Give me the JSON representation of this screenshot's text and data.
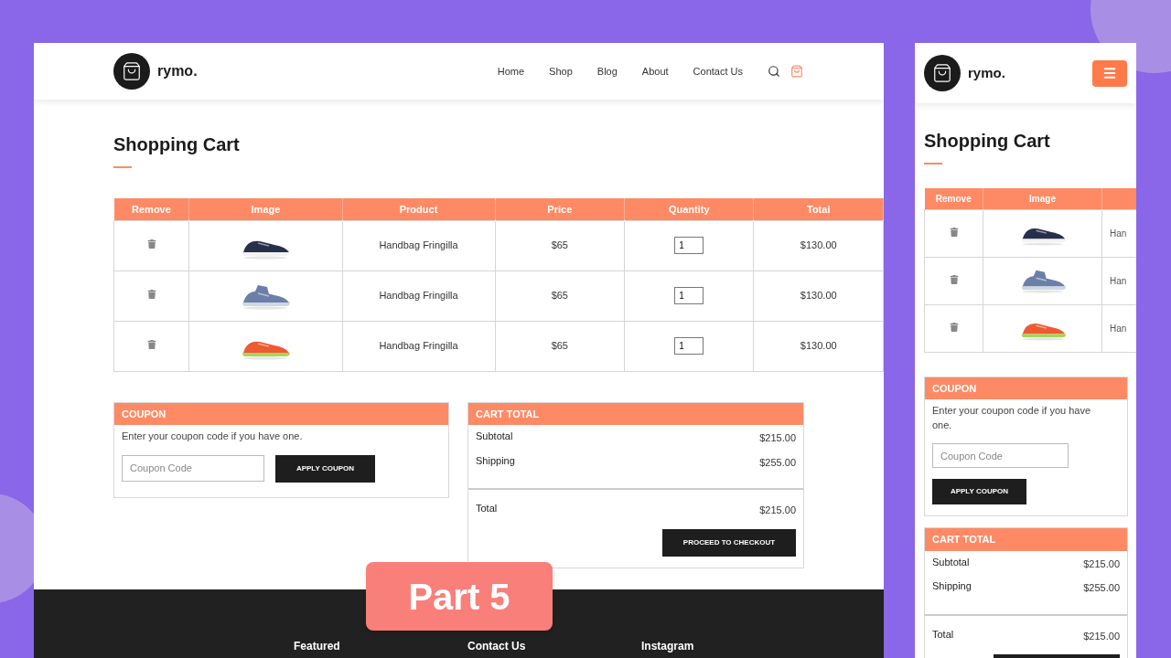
{
  "desktop": {
    "logo": "rymo.",
    "nav": [
      {
        "label": "Home"
      },
      {
        "label": "Shop"
      },
      {
        "label": "Blog"
      },
      {
        "label": "About"
      },
      {
        "label": "Contact Us"
      }
    ],
    "title": "Shopping Cart",
    "columns": [
      "Remove",
      "Image",
      "Product",
      "Price",
      "Quantity",
      "Total"
    ],
    "rows": [
      {
        "product": "Handbag Fringilla",
        "price": "$65",
        "quantity": "1",
        "total": "$130.00"
      },
      {
        "product": "Handbag Fringilla",
        "price": "$65",
        "quantity": "1",
        "total": "$130.00"
      },
      {
        "product": "Handbag Fringilla",
        "price": "$65",
        "quantity": "1",
        "total": "$130.00"
      }
    ],
    "coupon": {
      "title": "COUPON",
      "text": "Enter your coupon code if you have one.",
      "placeholder": "Coupon Code",
      "button": "APPLY COUPON"
    },
    "cart_total": {
      "title": "CART TOTAL",
      "lines": [
        {
          "label": "Subtotal",
          "value": "$215.00"
        },
        {
          "label": "Shipping",
          "value": "$255.00"
        }
      ],
      "total": {
        "label": "Total",
        "value": "$215.00"
      },
      "button": "PROCEED TO CHECKOUT"
    },
    "footer_headings": [
      "Featured",
      "Contact Us",
      "Instagram"
    ]
  },
  "mobile": {
    "logo": "rymo.",
    "title": "Shopping Cart",
    "columns": [
      "Remove",
      "Image"
    ],
    "rows": [
      {
        "product": "Han"
      },
      {
        "product": "Han"
      },
      {
        "product": "Han"
      }
    ],
    "coupon": {
      "title": "COUPON",
      "text": "Enter your coupon code if you have one.",
      "placeholder": "Coupon Code",
      "button": "APPLY COUPON"
    },
    "cart_total": {
      "title": "CART TOTAL",
      "lines": [
        {
          "label": "Subtotal",
          "value": "$215.00"
        },
        {
          "label": "Shipping",
          "value": "$255.00"
        }
      ],
      "total": {
        "label": "Total",
        "value": "$215.00"
      }
    }
  },
  "badge": "Part 5"
}
